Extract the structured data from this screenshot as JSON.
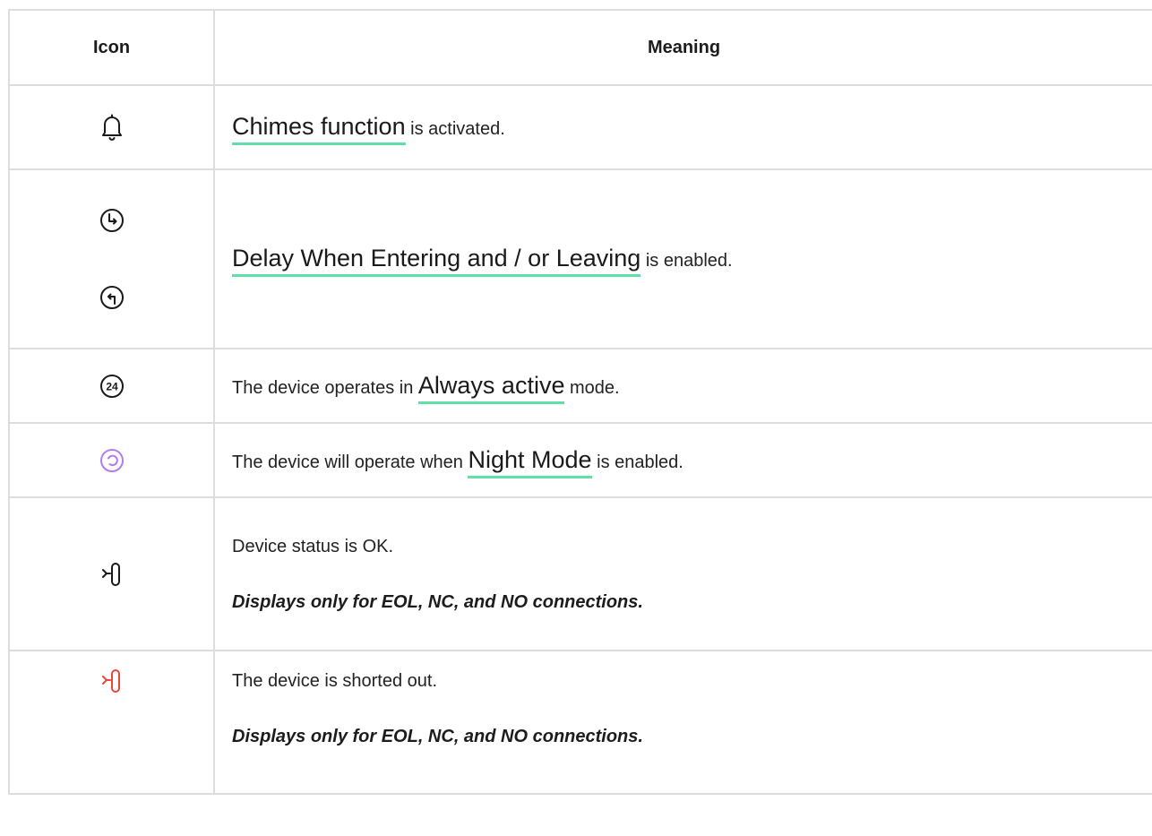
{
  "table": {
    "headers": {
      "icon": "Icon",
      "meaning": "Meaning"
    },
    "rows": [
      {
        "icons": [
          "bell-icon"
        ],
        "link": "Chimes function",
        "after": " is activated."
      },
      {
        "icons": [
          "entry-delay-icon",
          "exit-delay-icon"
        ],
        "link": "Delay When Entering and / or Leaving",
        "after": " is enabled."
      },
      {
        "icons": [
          "always-active-24-icon"
        ],
        "icon_text": "24",
        "before": "The device operates in ",
        "link": "Always active",
        "after": " mode."
      },
      {
        "icons": [
          "night-mode-icon"
        ],
        "icon_color": "#b07cf0",
        "before": "The device will operate when ",
        "link": "Night Mode",
        "after": " is enabled."
      },
      {
        "icons": [
          "device-status-ok-icon"
        ],
        "text": "Device status is OK.",
        "note": "Displays only for EOL, NC, and NO connections."
      },
      {
        "icons": [
          "device-shorted-icon"
        ],
        "icon_color": "#e8493c",
        "text": "The device is shorted out.",
        "note": "Displays only for EOL, NC, and NO connections."
      }
    ]
  },
  "colors": {
    "link_underline": "#5ee0a8",
    "border": "#dddddd",
    "text": "#222222",
    "night_mode_icon": "#b07cf0",
    "shorted_icon": "#e8493c"
  }
}
